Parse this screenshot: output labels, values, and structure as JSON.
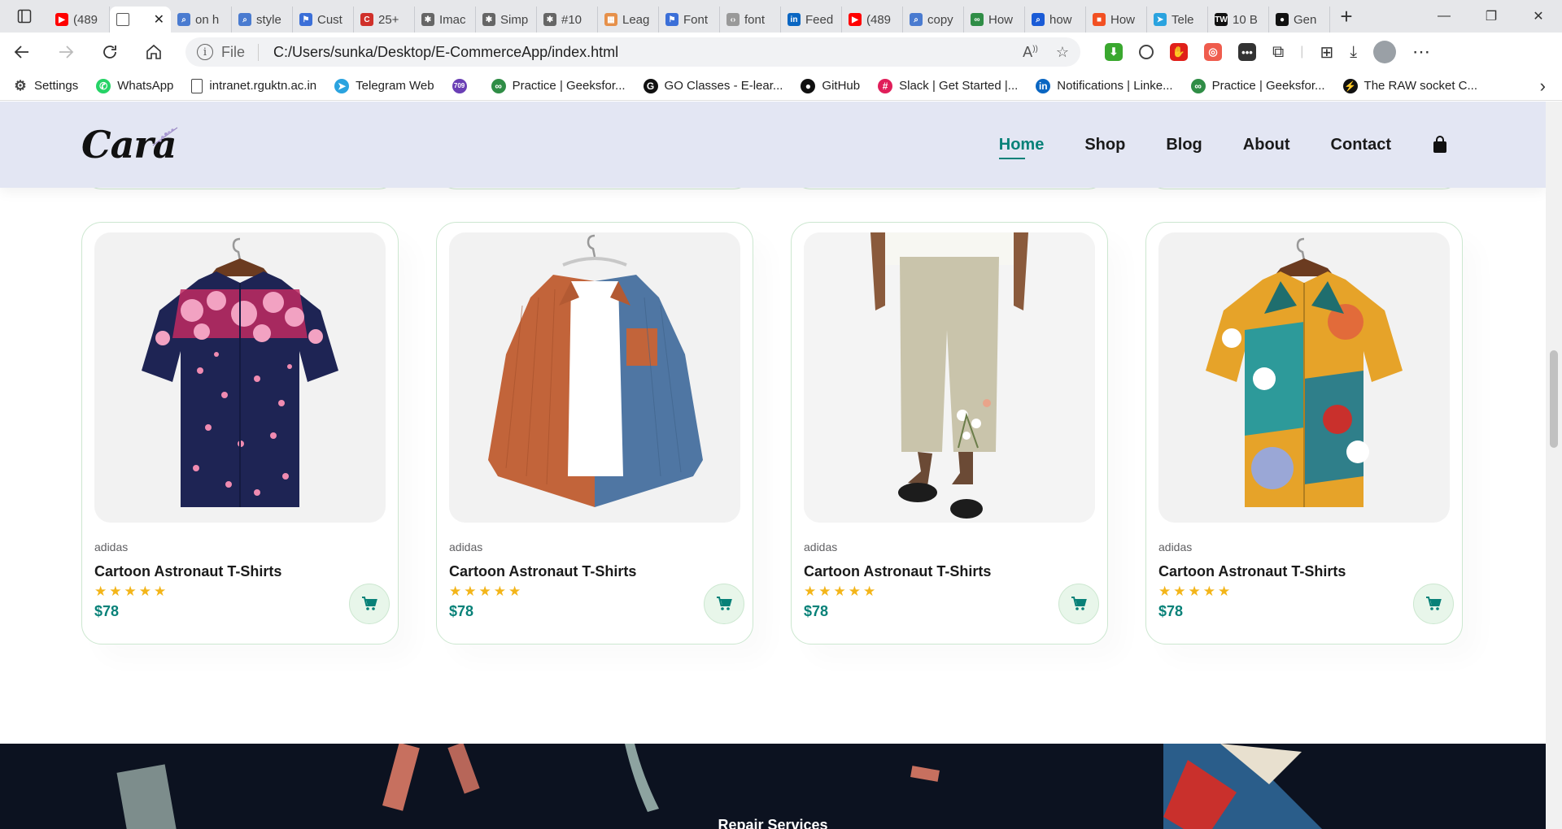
{
  "browser": {
    "tabs": [
      {
        "label": "(489",
        "icon": "youtube-icon",
        "color": "#ff0000"
      },
      {
        "label": "",
        "icon": "page-icon",
        "active": true
      },
      {
        "label": "on h",
        "icon": "search-icon",
        "color": "#4a7bd0"
      },
      {
        "label": "style",
        "icon": "search-icon",
        "color": "#4a7bd0"
      },
      {
        "label": "Cust",
        "icon": "flag-icon",
        "color": "#3b6fd8"
      },
      {
        "label": "25+",
        "icon": "cc-icon",
        "color": "#d0302a"
      },
      {
        "label": "Imac",
        "icon": "openai-icon",
        "color": "#666666"
      },
      {
        "label": "Simp",
        "icon": "openai-icon",
        "color": "#666666"
      },
      {
        "label": "#10",
        "icon": "openai-icon",
        "color": "#666666"
      },
      {
        "label": "Leag",
        "icon": "mixed-icon",
        "color": "#e6904a"
      },
      {
        "label": "Font",
        "icon": "flag-icon",
        "color": "#3b6fd8"
      },
      {
        "label": "font",
        "icon": "code-icon",
        "color": "#999999"
      },
      {
        "label": "Feed",
        "icon": "linkedin-icon",
        "color": "#0a66c2"
      },
      {
        "label": "(489",
        "icon": "youtube-icon",
        "color": "#ff0000"
      },
      {
        "label": "copy",
        "icon": "search-icon",
        "color": "#4a7bd0"
      },
      {
        "label": "How",
        "icon": "gfg-icon",
        "color": "#2f8d46"
      },
      {
        "label": "how",
        "icon": "search-icon",
        "color": "#1a5bd6"
      },
      {
        "label": "How",
        "icon": "microsoft-icon",
        "color": "#f25022"
      },
      {
        "label": "Tele",
        "icon": "telegram-icon",
        "color": "#2aa3df"
      },
      {
        "label": "10 B",
        "icon": "tw-icon",
        "color": "#111111"
      },
      {
        "label": "Gen",
        "icon": "github-icon",
        "color": "#111111"
      }
    ],
    "address": {
      "scheme": "File",
      "url": "C:/Users/sunka/Desktop/E-CommerceApp/index.html"
    },
    "bookmarks": [
      {
        "label": "Settings",
        "icon": "gear-icon",
        "color": "#444444"
      },
      {
        "label": "WhatsApp",
        "icon": "whatsapp-icon",
        "color": "#25d366"
      },
      {
        "label": "intranet.rguktn.ac.in",
        "icon": "page-icon",
        "color": "#444444"
      },
      {
        "label": "Telegram Web",
        "icon": "telegram-icon",
        "color": "#2aa3df"
      },
      {
        "label": "",
        "icon": "badge-709-icon",
        "color": "#6a3fb5"
      },
      {
        "label": "Practice | Geeksfor...",
        "icon": "gfg-icon",
        "color": "#2f8d46"
      },
      {
        "label": "GO Classes - E-lear...",
        "icon": "go-classes-icon",
        "color": "#111111"
      },
      {
        "label": "GitHub",
        "icon": "github-icon",
        "color": "#111111"
      },
      {
        "label": "Slack | Get Started |...",
        "icon": "slack-icon",
        "color": "#e01e5a"
      },
      {
        "label": "Notifications | Linke...",
        "icon": "linkedin-icon",
        "color": "#0a66c2"
      },
      {
        "label": "Practice | Geeksfor...",
        "icon": "gfg-icon",
        "color": "#2f8d46"
      },
      {
        "label": "The RAW socket C...",
        "icon": "raw-icon",
        "color": "#111111"
      }
    ]
  },
  "site": {
    "logo": "Cara",
    "nav": [
      "Home",
      "Shop",
      "Blog",
      "About",
      "Contact"
    ],
    "active_nav": "Home",
    "accent": "#088178",
    "header_bg": "#e3e6f3"
  },
  "products": [
    {
      "brand": "adidas",
      "title": "Cartoon Astronaut T-Shirts",
      "stars": "★★★★★",
      "price": "$78",
      "image": "floral-navy-shirt"
    },
    {
      "brand": "adidas",
      "title": "Cartoon Astronaut T-Shirts",
      "stars": "★★★★★",
      "price": "$78",
      "image": "corduroy-two-tone-shirt"
    },
    {
      "brand": "adidas",
      "title": "Cartoon Astronaut T-Shirts",
      "stars": "★★★★★",
      "price": "$78",
      "image": "linen-floral-pants"
    },
    {
      "brand": "adidas",
      "title": "Cartoon Astronaut T-Shirts",
      "stars": "★★★★★",
      "price": "$78",
      "image": "abstract-print-shirt"
    }
  ],
  "banner": {
    "caption": "Repair Services",
    "bg": "#0c1220"
  }
}
